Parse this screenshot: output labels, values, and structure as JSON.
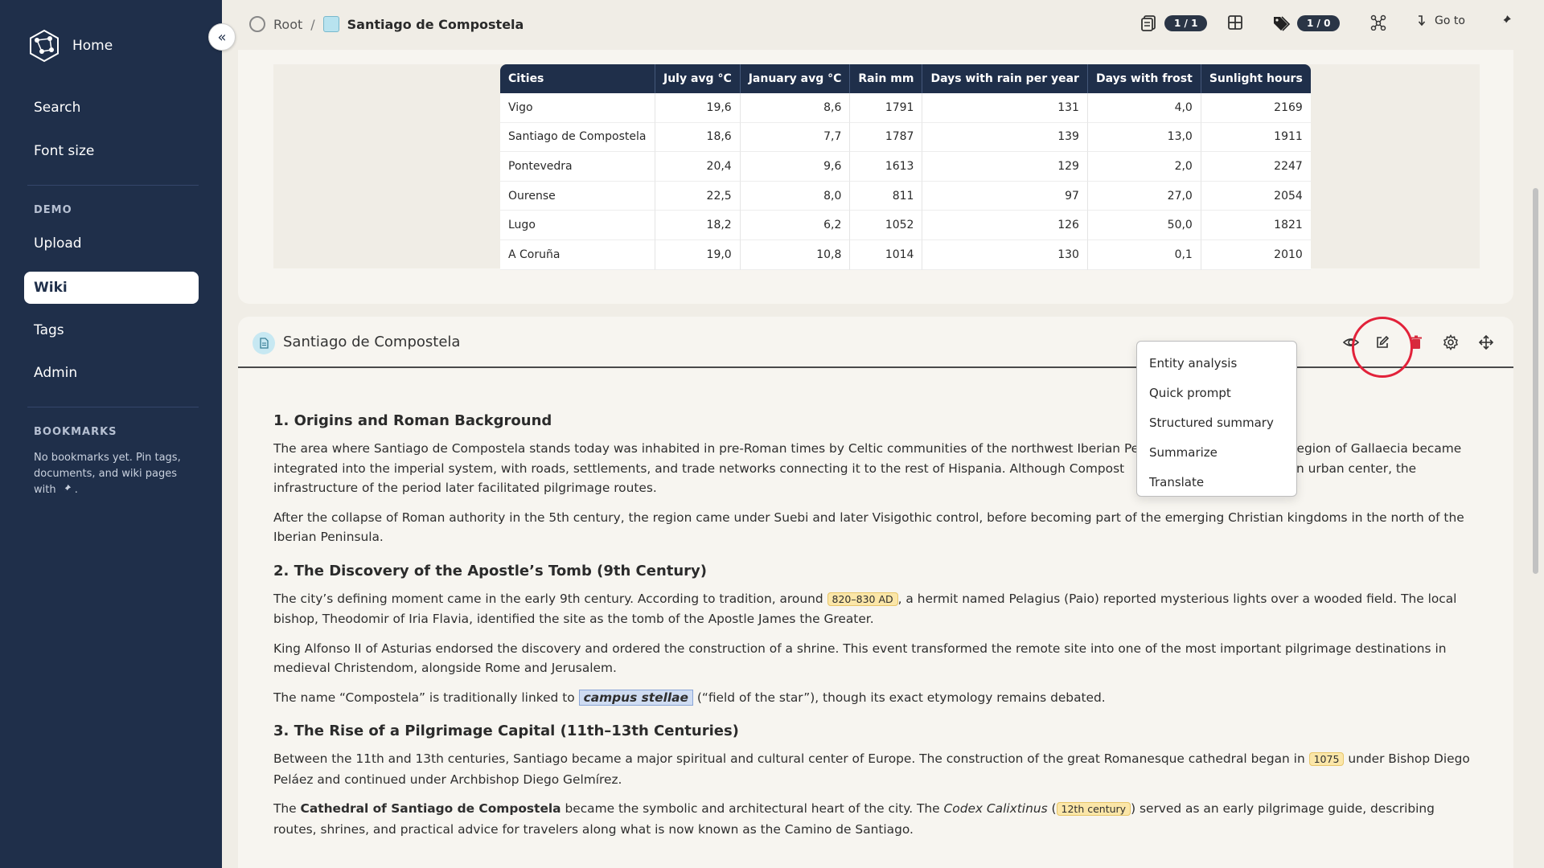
{
  "sidebar": {
    "brand": "Home",
    "nav": [
      "Search",
      "Font size"
    ],
    "demo_title": "DEMO",
    "demo_items": [
      "Upload",
      "Wiki",
      "Tags",
      "Admin"
    ],
    "bookmarks_title": "BOOKMARKS",
    "bookmarks_note": "No bookmarks yet. Pin tags, documents, and wiki pages with",
    "bookmarks_note_end": ".",
    "collapse_label": "«"
  },
  "breadcrumb": {
    "root": "Root",
    "separator": "/",
    "current": "Santiago de Compostela"
  },
  "toolbar": {
    "documents_badge": "1 / 1",
    "tags_badge": "1 / 0",
    "goto_label": "Go to"
  },
  "table": {
    "headers": [
      "Cities",
      "July avg °C",
      "January avg °C",
      "Rain mm",
      "Days with rain per year",
      "Days with frost",
      "Sunlight hours"
    ],
    "rows": [
      [
        "Vigo",
        "19,6",
        "8,6",
        "1791",
        "131",
        "4,0",
        "2169"
      ],
      [
        "Santiago de Compostela",
        "18,6",
        "7,7",
        "1787",
        "139",
        "13,0",
        "1911"
      ],
      [
        "Pontevedra",
        "20,4",
        "9,6",
        "1613",
        "129",
        "2,0",
        "2247"
      ],
      [
        "Ourense",
        "22,5",
        "8,0",
        "811",
        "97",
        "27,0",
        "2054"
      ],
      [
        "Lugo",
        "18,2",
        "6,2",
        "1052",
        "126",
        "50,0",
        "1821"
      ],
      [
        "A Coruña",
        "19,0",
        "10,8",
        "1014",
        "130",
        "0,1",
        "2010"
      ]
    ]
  },
  "card": {
    "title": "Santiago de Compostela"
  },
  "menu": {
    "items": [
      "Entity analysis",
      "Quick prompt",
      "Structured summary",
      "Summarize",
      "Translate"
    ]
  },
  "article": {
    "s1_title": "1. Origins and Roman Background",
    "s1_p1a": "The area where Santiago de Compostela stands today was inhabited in pre-Roman times by Celtic communities of the northwest Iberian Peninsula. ",
    "s1_p1b": "oader region of Gallaecia became integrated into the imperial system, with roads, settlements, and trade networks connecting it to the rest of Hispania. Although Compost",
    "s1_p1c": "oman urban center, the infrastructure of the period later facilitated pilgrimage routes.",
    "s1_p2": "After the collapse of Roman authority in the 5th century, the region came under Suebi and later Visigothic control, before becoming part of the emerging Christian kingdoms in the north of the Iberian Peninsula.",
    "s2_title": "2. The Discovery of the Apostle’s Tomb (9th Century)",
    "s2_p1a": "The city’s defining moment came in the early 9th century. According to tradition, around",
    "s2_p1_tag": "820–830 AD",
    "s2_p1b": ", a hermit named Pelagius (Paio) reported mysterious lights over a wooded field. The local bishop, Theodomir of Iria Flavia, identified the site as the tomb of the Apostle James the Greater.",
    "s2_p2": "King Alfonso II of Asturias endorsed the discovery and ordered the construction of a shrine. This event transformed the remote site into one of the most important pilgrimage destinations in medieval Christendom, alongside Rome and Jerusalem.",
    "s2_p3a": "The name “Compostela” is traditionally linked to",
    "s2_p3_ent": "campus stellae",
    "s2_p3b": "(“field of the star”), though its exact etymology remains debated.",
    "s3_title": "3. The Rise of a Pilgrimage Capital (11th–13th Centuries)",
    "s3_p1a": "Between the 11th and 13th centuries, Santiago became a major spiritual and cultural center of Europe. The construction of the great Romanesque cathedral began in",
    "s3_p1_tag": "1075",
    "s3_p1b": "under Bishop Diego Peláez and continued under Archbishop Diego Gelmírez.",
    "s3_p2a": "The",
    "s3_p2_bold": "Cathedral of Santiago de Compostela",
    "s3_p2b": "became the symbolic and architectural heart of the city. The",
    "s3_p2_italic": "Codex Calixtinus",
    "s3_p2c": "(",
    "s3_p2_tag": "12th century",
    "s3_p2d": ") served as an early pilgrimage guide, describing routes, shrines, and practical advice for travelers along what is now known as the Camino de Santiago."
  },
  "colors": {
    "sidebar_bg": "#1f2f4a",
    "accent_red": "#e2223a",
    "date_tag": "#fbe6a8",
    "entity_highlight": "#cfdcf2"
  }
}
